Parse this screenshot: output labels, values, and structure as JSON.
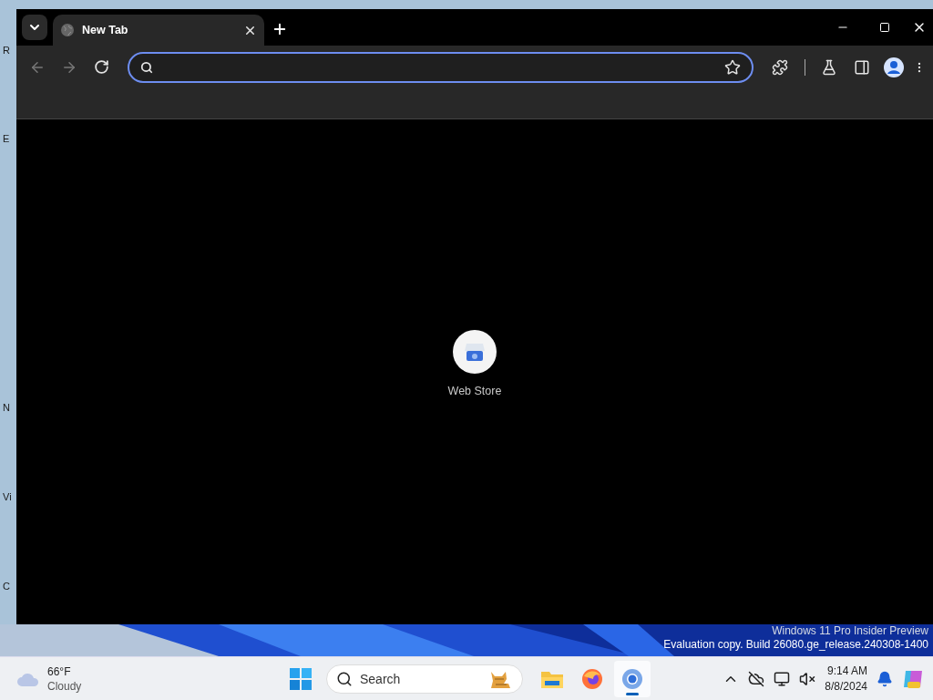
{
  "desktop": {
    "icon_labels": [
      "R",
      "E",
      "N",
      "Vi",
      "C"
    ],
    "watermark": [
      "Windows 11 Pro Insider Preview",
      "Evaluation copy. Build 26080.ge_release.240308-1400"
    ]
  },
  "browser": {
    "tabs": [
      {
        "title": "New Tab",
        "selected": true
      }
    ],
    "address_bar": {
      "focused": true
    },
    "shortcuts": [
      {
        "label": "Web Store"
      }
    ]
  },
  "taskbar": {
    "weather": {
      "temperature": "66°F",
      "condition": "Cloudy"
    },
    "search": {
      "placeholder": "Search"
    },
    "apps": [
      {
        "kind": "folder",
        "active": false
      },
      {
        "kind": "firefox",
        "active": false
      },
      {
        "kind": "chrome",
        "active": true
      }
    ],
    "clock": {
      "time": "9:14 AM",
      "date": "8/8/2024"
    }
  }
}
